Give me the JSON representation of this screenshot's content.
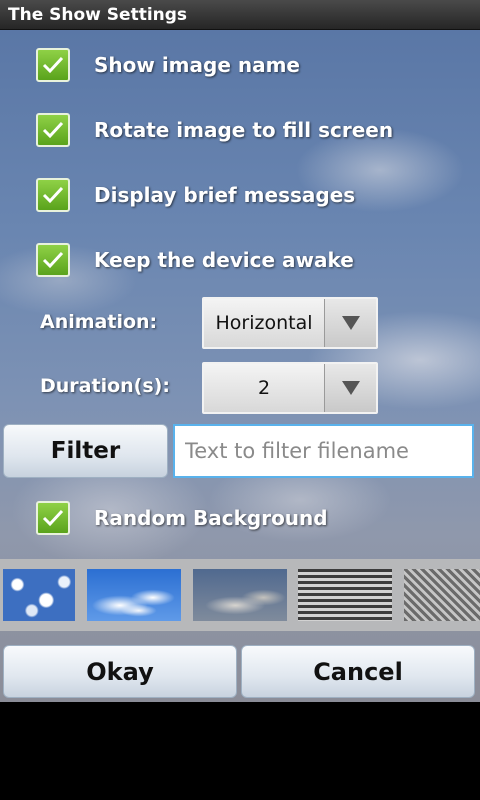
{
  "title": "The Show Settings",
  "options": [
    {
      "label": "Show image name",
      "checked": true
    },
    {
      "label": "Rotate image to fill screen",
      "checked": true
    },
    {
      "label": "Display brief messages",
      "checked": true
    },
    {
      "label": "Keep the device awake",
      "checked": true
    }
  ],
  "animation": {
    "label": "Animation:",
    "value": "Horizontal"
  },
  "duration": {
    "label": "Duration(s):",
    "value": "2"
  },
  "filter": {
    "button_label": "Filter",
    "placeholder": "Text to filter filename",
    "value": ""
  },
  "random_background": {
    "label": "Random Background",
    "checked": true
  },
  "backgrounds": [
    "cloud pattern",
    "blue sky clouds",
    "evening clouds",
    "horizontal stripes",
    "diagonal weave"
  ],
  "buttons": {
    "okay": "Okay",
    "cancel": "Cancel"
  },
  "colors": {
    "checkbox": "#6bb928",
    "input_focus": "#59b2ec"
  }
}
